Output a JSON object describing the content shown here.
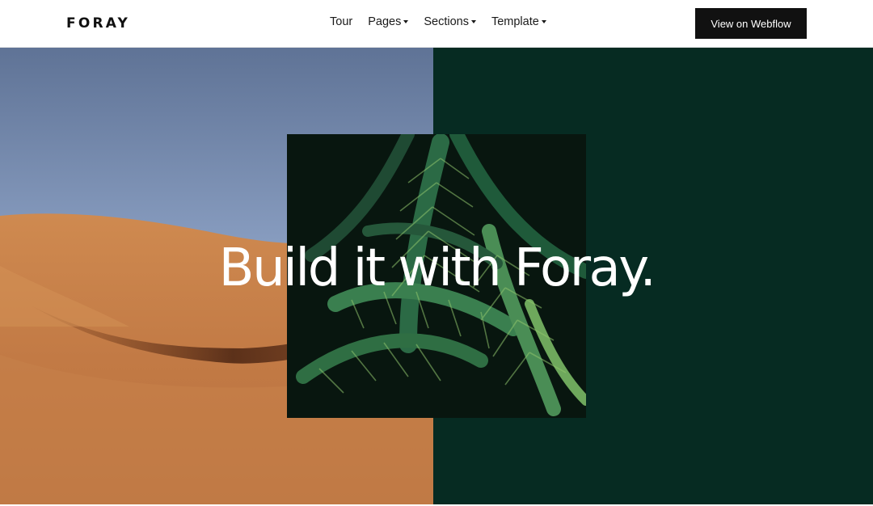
{
  "header": {
    "brand": "FORAY",
    "nav": [
      {
        "label": "Tour",
        "has_dropdown": false
      },
      {
        "label": "Pages",
        "has_dropdown": true
      },
      {
        "label": "Sections",
        "has_dropdown": true
      },
      {
        "label": "Template",
        "has_dropdown": true
      }
    ],
    "cta_label": "View on Webflow"
  },
  "hero": {
    "headline": "Build it with Foray.",
    "left_image": "desert-dune-photo",
    "center_image": "palm-leaves-photo",
    "colors": {
      "right_panel": "#062b22",
      "sky": "#8fa3c7",
      "sand": "#c9834e",
      "cta_bg": "#111111",
      "headline": "#ffffff"
    }
  }
}
